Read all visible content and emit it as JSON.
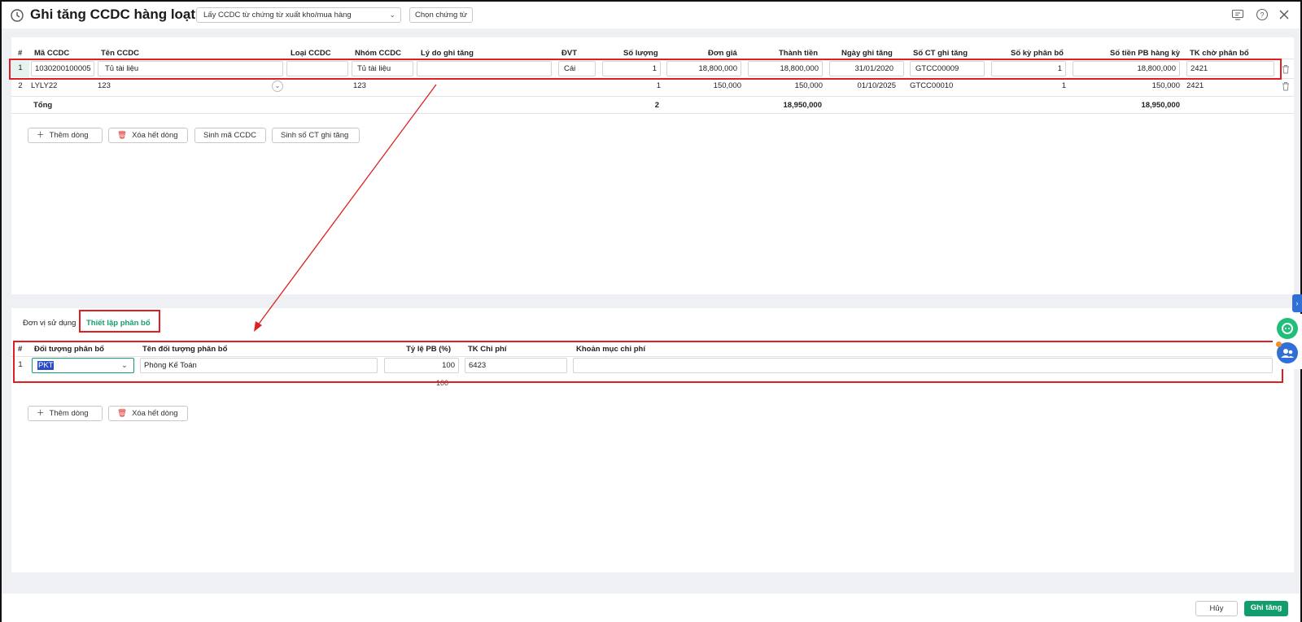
{
  "header": {
    "title": "Ghi tăng CCDC hàng loạt",
    "source_select": "Lấy CCDC từ chứng từ xuất kho/mua hàng",
    "choose_doc": "Chọn chứng từ"
  },
  "grid": {
    "headers": [
      "#",
      "Mã CCDC",
      "Tên CCDC",
      "Loại CCDC",
      "Nhóm CCDC",
      "Lý do ghi tăng",
      "ĐVT",
      "Số lượng",
      "Đơn giá",
      "Thành tiền",
      "Ngày ghi tăng",
      "Số CT ghi tăng",
      "Số kỳ phân bổ",
      "Số tiền PB hàng kỳ",
      "TK chờ phân bổ"
    ],
    "rows": [
      {
        "no": "1",
        "code": "1030200100005",
        "name": "Tủ tài liệu",
        "type": "",
        "group": "Tủ tài liệu",
        "reason": "",
        "unit": "Cái",
        "qty": "1",
        "price": "18,800,000",
        "amount": "18,800,000",
        "date": "31/01/2020",
        "doc": "GTCC00009",
        "periods": "1",
        "per_amount": "18,800,000",
        "account": "2421"
      },
      {
        "no": "2",
        "code": "LYLY22",
        "name": "123",
        "type": "",
        "group": "123",
        "reason": "",
        "unit": "",
        "qty": "1",
        "price": "150,000",
        "amount": "150,000",
        "date": "01/10/2025",
        "doc": "GTCC00010",
        "periods": "1",
        "per_amount": "150,000",
        "account": "2421"
      }
    ],
    "total": {
      "label": "Tổng",
      "qty": "2",
      "amount": "18,950,000",
      "per_amount": "18,950,000"
    }
  },
  "grid_buttons": {
    "add": "Thêm dòng",
    "clear": "Xóa hết dòng",
    "gen_code": "Sinh mã CCDC",
    "gen_doc": "Sinh số CT ghi tăng"
  },
  "tabs": {
    "units": "Đơn vị sử dụng",
    "allocation": "Thiết lập phân bổ"
  },
  "alloc": {
    "headers": [
      "#",
      "Đối tượng phân bổ",
      "Tên đối tượng phân bổ",
      "Tỷ lệ PB (%)",
      "TK Chi phí",
      "Khoản mục chi phí"
    ],
    "row": {
      "no": "1",
      "object": "PKT",
      "object_name": "Phòng Kế Toán",
      "rate": "100",
      "account": "6423",
      "item": ""
    },
    "total_rate": "100"
  },
  "alloc_buttons": {
    "add": "Thêm dòng",
    "clear": "Xóa hết dòng"
  },
  "footer": {
    "cancel": "Hủy",
    "save": "Ghi tăng"
  },
  "icons": [
    "history-icon",
    "chevron-down-icon",
    "feedback-icon",
    "help-icon",
    "close-icon",
    "plus-icon",
    "trash-icon",
    "chat-icon",
    "group-icon",
    "chevron-right-icon"
  ],
  "colors": {
    "accent": "#119e6c",
    "highlight": "#e02020",
    "side_tab": "#2f6fd6"
  }
}
